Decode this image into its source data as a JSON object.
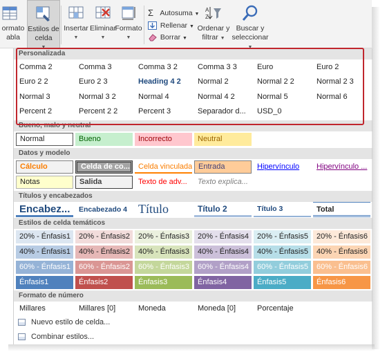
{
  "ribbon": {
    "formato_tabla": "ormato",
    "formato_tabla2": "abla",
    "estilos_celda": "Estilos de",
    "estilos_celda2": "celda",
    "insertar": "Insertar",
    "eliminar": "Eliminar",
    "formato": "Formato",
    "autosuma": "Autosuma",
    "rellenar": "Rellenar",
    "borrar": "Borrar",
    "ordenar": "Ordenar y",
    "ordenar2": "filtrar",
    "buscar": "Buscar y",
    "buscar2": "seleccionar"
  },
  "sections": {
    "personalizada": "Personalizada",
    "bueno_malo": "Bueno, malo y neutral",
    "datos_modelo": "Datos y modelo",
    "titulos": "Títulos y encabezados",
    "tematicos": "Estilos de celda temáticos",
    "formato_numero": "Formato de número"
  },
  "personalizada": [
    [
      "Comma 2",
      "Comma 3",
      "Comma 3 2",
      "Comma 3 3",
      "Euro",
      "Euro 2"
    ],
    [
      "Euro 2 2",
      "Euro 2 3",
      "Heading 4 2",
      "Normal 2",
      "Normal 2 2",
      "Normal 2 3"
    ],
    [
      "Normal 3",
      "Normal 3 2",
      "Normal 4",
      "Normal 4 2",
      "Normal 5",
      "Normal 6"
    ],
    [
      "Percent 2",
      "Percent 2 2",
      "Percent 3",
      "Separador d...",
      "USD_0"
    ]
  ],
  "bueno_malo": [
    "Normal",
    "Bueno",
    "Incorrecto",
    "Neutral"
  ],
  "datos_modelo": [
    [
      "Cálculo",
      "Celda de co...",
      "Celda vinculada",
      "Entrada",
      "Hipervínculo",
      "Hipervínculo ..."
    ],
    [
      "Notas",
      "Salida",
      "Texto de adv...",
      "Texto explica..."
    ]
  ],
  "titulos": [
    "Encabez...",
    "Encabezado 4",
    "Título",
    "Título 2",
    "Título 3",
    "Total"
  ],
  "tematicos": [
    [
      "20% - Énfasis1",
      "20% - Énfasis2",
      "20% - Énfasis3",
      "20% - Énfasis4",
      "20% - Énfasis5",
      "20% - Énfasis6"
    ],
    [
      "40% - Énfasis1",
      "40% - Énfasis2",
      "40% - Énfasis3",
      "40% - Énfasis4",
      "40% - Énfasis5",
      "40% - Énfasis6"
    ],
    [
      "60% - Énfasis1",
      "60% - Énfasis2",
      "60% - Énfasis3",
      "60% - Énfasis4",
      "60% - Énfasis5",
      "60% - Énfasis6"
    ],
    [
      "Énfasis1",
      "Énfasis2",
      "Énfasis3",
      "Énfasis4",
      "Énfasis5",
      "Énfasis6"
    ]
  ],
  "formato_numero": [
    "Millares",
    "Millares [0]",
    "Moneda",
    "Moneda [0]",
    "Porcentaje"
  ],
  "footer": {
    "nuevo": "Nuevo estilo de celda...",
    "combinar": "Combinar estilos..."
  },
  "colors": {
    "highlight": "#c0262d",
    "accent1": "#4f81bd",
    "accent2": "#c0504d",
    "accent3": "#9bbb59",
    "accent4": "#8064a2",
    "accent5": "#4bacc6",
    "accent6": "#f79646"
  }
}
